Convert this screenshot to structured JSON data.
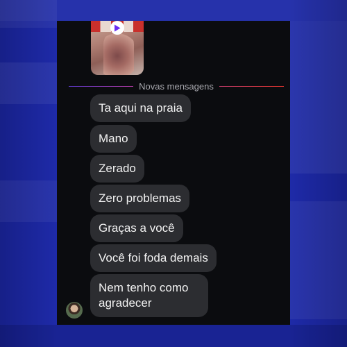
{
  "divider": {
    "label": "Novas mensagens"
  },
  "messages": [
    {
      "text": "Ta aqui na praia"
    },
    {
      "text": "Mano"
    },
    {
      "text": "Zerado"
    },
    {
      "text": "Zero problemas"
    },
    {
      "text": "Graças a você"
    },
    {
      "text": "Você foi foda demais"
    },
    {
      "text": "Nem tenho como agradecer"
    }
  ],
  "icons": {
    "play": "play-icon",
    "avatar": "avatar"
  },
  "colors": {
    "background": "#1e2aa8",
    "chat_bg": "#0b0c0f",
    "bubble": "#2c2d31",
    "bubble_text": "#f2f2f2",
    "divider_text": "#a8a8ae",
    "play_icon": "#6a2cf2"
  }
}
